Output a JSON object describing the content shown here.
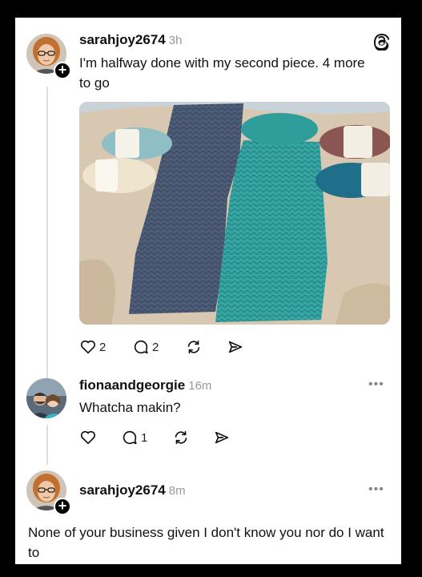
{
  "post": {
    "username": "sarahjoy2674",
    "time": "3h",
    "text": "I'm halfway done with my second piece. 4 more to go",
    "likes": "2",
    "replies": "2"
  },
  "reply1": {
    "username": "fionaandgeorgie",
    "time": "16m",
    "text": "Whatcha makin?",
    "replies": "1"
  },
  "reply2": {
    "username": "sarahjoy2674",
    "time": "8m",
    "text": "None of your business given I don't know you nor do I want to"
  },
  "icons": {
    "logo": "threads-logo-icon",
    "like": "heart-icon",
    "reply": "comment-icon",
    "repost": "repost-icon",
    "share": "send-icon",
    "more": "more-icon",
    "follow": "plus-icon"
  },
  "colors": {
    "background": "#000000",
    "card": "#ffffff",
    "text": "#111111",
    "muted": "#999999",
    "thread_line": "#dedede"
  }
}
